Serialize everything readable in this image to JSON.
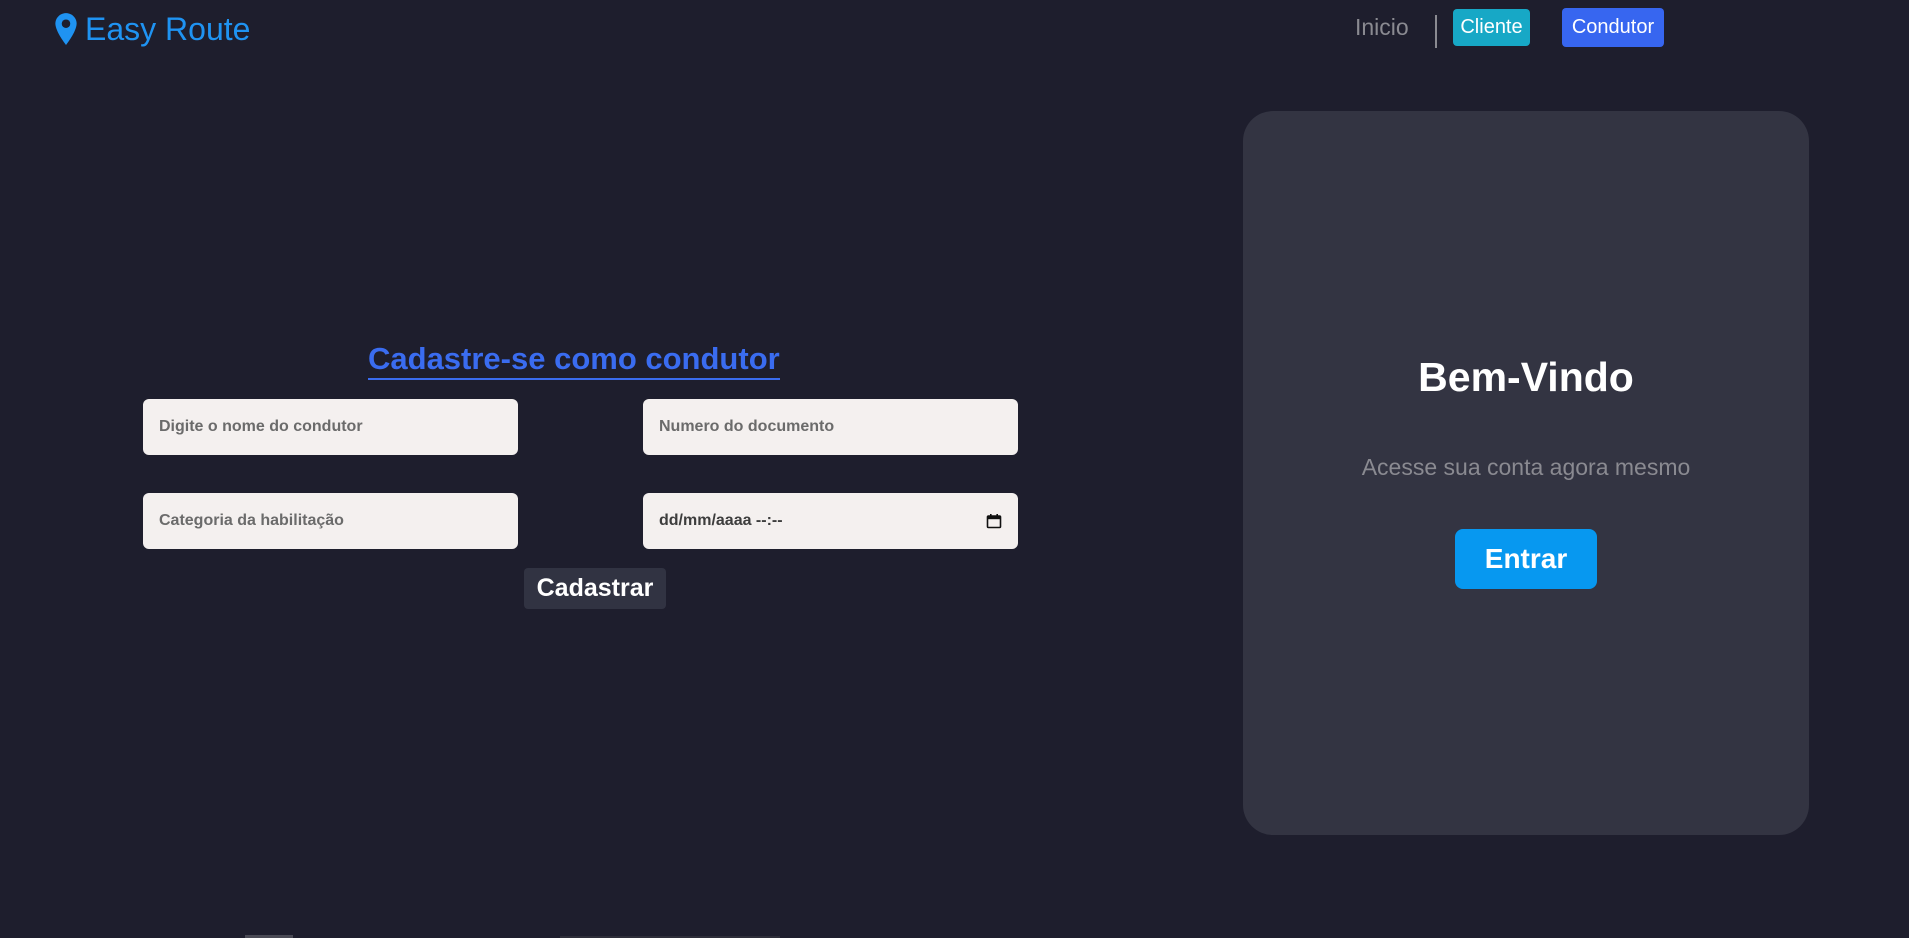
{
  "header": {
    "brand_name": "Easy Route",
    "brand_icon": "map-pin-icon",
    "brand_color": "#1f93f2",
    "nav": {
      "inicio_label": "Inicio",
      "cliente_label": "Cliente",
      "condutor_label": "Condutor"
    }
  },
  "form": {
    "title": "Cadastre-se como condutor",
    "nome_placeholder": "Digite o nome do condutor",
    "documento_placeholder": "Numero do documento",
    "categoria_placeholder": "Categoria da habilitação",
    "date_placeholder": "dd/mm/aaaa  --:--",
    "date_icon": "calendar-icon",
    "submit_label": "Cadastrar"
  },
  "welcome": {
    "title": "Bem-Vindo",
    "subtitle": "Acesse sua conta agora mesmo",
    "button_label": "Entrar"
  },
  "colors": {
    "background": "#1e1e2d",
    "card": "#333442",
    "accent_blue": "#3a6cf0",
    "cliente_button": "#17a8c6",
    "condutor_button": "#3766f0",
    "entrar_button": "#0798f0"
  }
}
